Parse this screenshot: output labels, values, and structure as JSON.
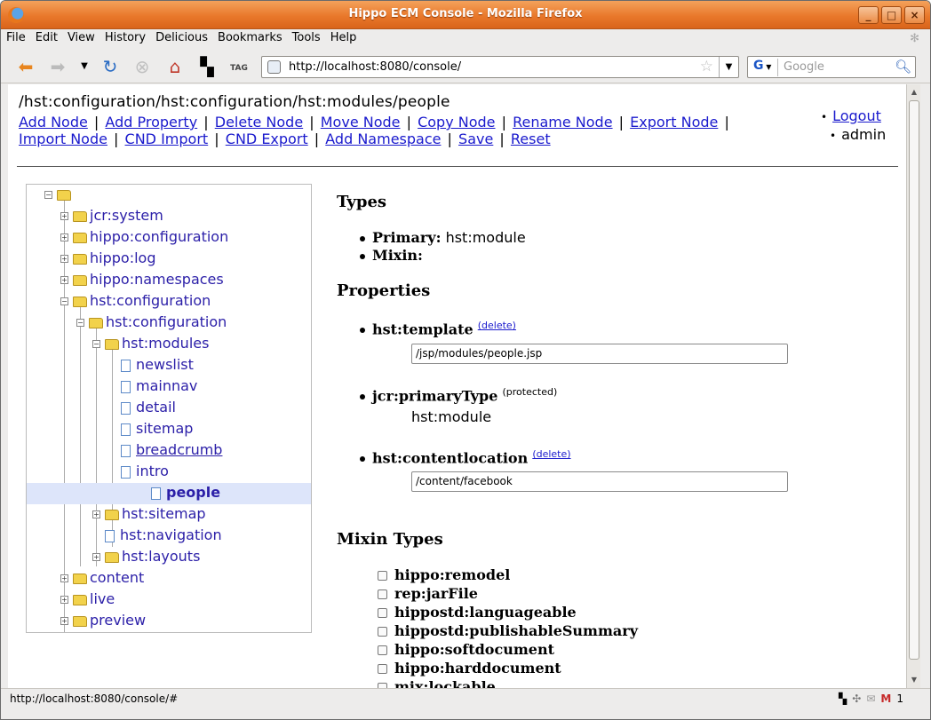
{
  "window": {
    "title": "Hippo ECM Console - Mozilla Firefox",
    "buttons": [
      "_",
      "□",
      "×"
    ]
  },
  "menu": [
    "File",
    "Edit",
    "View",
    "History",
    "Delicious",
    "Bookmarks",
    "Tools",
    "Help"
  ],
  "navbar": {
    "url": "http://localhost:8080/console/",
    "search_engine": "G",
    "search_placeholder": "Google"
  },
  "status": {
    "text": "http://localhost:8080/console/#",
    "mail_count": "1"
  },
  "page": {
    "path": "/hst:configuration/hst:configuration/hst:modules/people",
    "actions": [
      "Add Node",
      "Add Property",
      "Delete Node",
      "Move Node",
      "Copy Node",
      "Rename Node",
      "Export Node",
      "Import Node",
      "CND Import",
      "CND Export",
      "Add Namespace",
      "Save",
      "Reset"
    ],
    "logout": "Logout",
    "user": "admin"
  },
  "tree": [
    {
      "label": "",
      "type": "folder",
      "toggle": "⊟",
      "level": 0
    },
    {
      "label": "jcr:system",
      "type": "folder",
      "toggle": "⊞",
      "level": 1
    },
    {
      "label": "hippo:configuration",
      "type": "folder",
      "toggle": "⊞",
      "level": 1
    },
    {
      "label": "hippo:log",
      "type": "folder",
      "toggle": "⊞",
      "level": 1
    },
    {
      "label": "hippo:namespaces",
      "type": "folder",
      "toggle": "⊞",
      "level": 1
    },
    {
      "label": "hst:configuration",
      "type": "folder",
      "toggle": "⊟",
      "level": 1
    },
    {
      "label": "hst:configuration",
      "type": "folder",
      "toggle": "⊟",
      "level": 2
    },
    {
      "label": "hst:modules",
      "type": "folder",
      "toggle": "⊟",
      "level": 3
    },
    {
      "label": "newslist",
      "type": "doc",
      "level": 4
    },
    {
      "label": "mainnav",
      "type": "doc",
      "level": 4
    },
    {
      "label": "detail",
      "type": "doc",
      "level": 4
    },
    {
      "label": "sitemap",
      "type": "doc",
      "level": 4
    },
    {
      "label": "breadcrumb",
      "type": "doc",
      "level": 4,
      "underline": true
    },
    {
      "label": "intro",
      "type": "doc",
      "level": 4
    },
    {
      "label": "people",
      "type": "doc",
      "level": 4,
      "selected": true
    },
    {
      "label": "hst:sitemap",
      "type": "folder",
      "toggle": "⊞",
      "level": 3
    },
    {
      "label": "hst:navigation",
      "type": "doc",
      "level": 3
    },
    {
      "label": "hst:layouts",
      "type": "folder",
      "toggle": "⊞",
      "level": 3
    },
    {
      "label": "content",
      "type": "folder",
      "toggle": "⊞",
      "level": 1
    },
    {
      "label": "live",
      "type": "folder",
      "toggle": "⊞",
      "level": 1
    },
    {
      "label": "preview",
      "type": "folder",
      "toggle": "⊞",
      "level": 1
    }
  ],
  "types": {
    "heading": "Types",
    "primary_label": "Primary:",
    "primary_value": "hst:module",
    "mixin_label": "Mixin:"
  },
  "properties": {
    "heading": "Properties",
    "template_label": "hst:template",
    "template_value": "/jsp/modules/people.jsp",
    "delete": "(delete)",
    "primarytype_label": "jcr:primaryType",
    "protected": "(protected)",
    "primarytype_value": "hst:module",
    "contentlocation_label": "hst:contentlocation",
    "contentlocation_value": "/content/facebook"
  },
  "mixins": {
    "heading": "Mixin Types",
    "items": [
      "hippo:remodel",
      "rep:jarFile",
      "hippostd:languageable",
      "hippostd:publishableSummary",
      "hippo:softdocument",
      "hippo:harddocument",
      "mix:lockable"
    ]
  }
}
